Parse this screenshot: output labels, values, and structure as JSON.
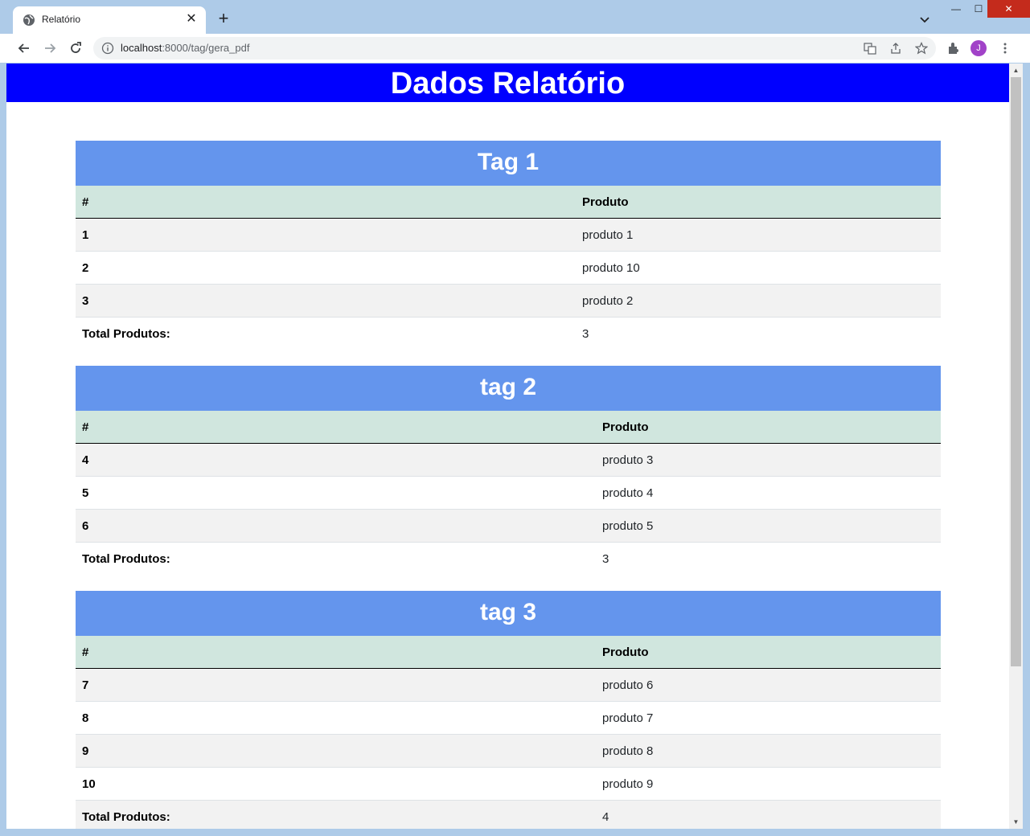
{
  "browser": {
    "tab_title": "Relatório",
    "url_host": "localhost",
    "url_rest": ":8000/tag/gera_pdf",
    "avatar_letter": "J"
  },
  "page": {
    "title": "Dados Relatório"
  },
  "sections": [
    {
      "title": "Tag 1",
      "col_num": "#",
      "col_product": "Produto",
      "rows": [
        {
          "num": "1",
          "product": "produto 1"
        },
        {
          "num": "2",
          "product": "produto 10"
        },
        {
          "num": "3",
          "product": "produto 2"
        }
      ],
      "total_label": "Total Produtos:",
      "total_value": "3"
    },
    {
      "title": "tag 2",
      "col_num": "#",
      "col_product": "Produto",
      "rows": [
        {
          "num": "4",
          "product": "produto 3"
        },
        {
          "num": "5",
          "product": "produto 4"
        },
        {
          "num": "6",
          "product": "produto 5"
        }
      ],
      "total_label": "Total Produtos:",
      "total_value": "3"
    },
    {
      "title": "tag 3",
      "col_num": "#",
      "col_product": "Produto",
      "rows": [
        {
          "num": "7",
          "product": "produto 6"
        },
        {
          "num": "8",
          "product": "produto 7"
        },
        {
          "num": "9",
          "product": "produto 8"
        },
        {
          "num": "10",
          "product": "produto 9"
        }
      ],
      "total_label": "Total Produtos:",
      "total_value": "4"
    }
  ]
}
